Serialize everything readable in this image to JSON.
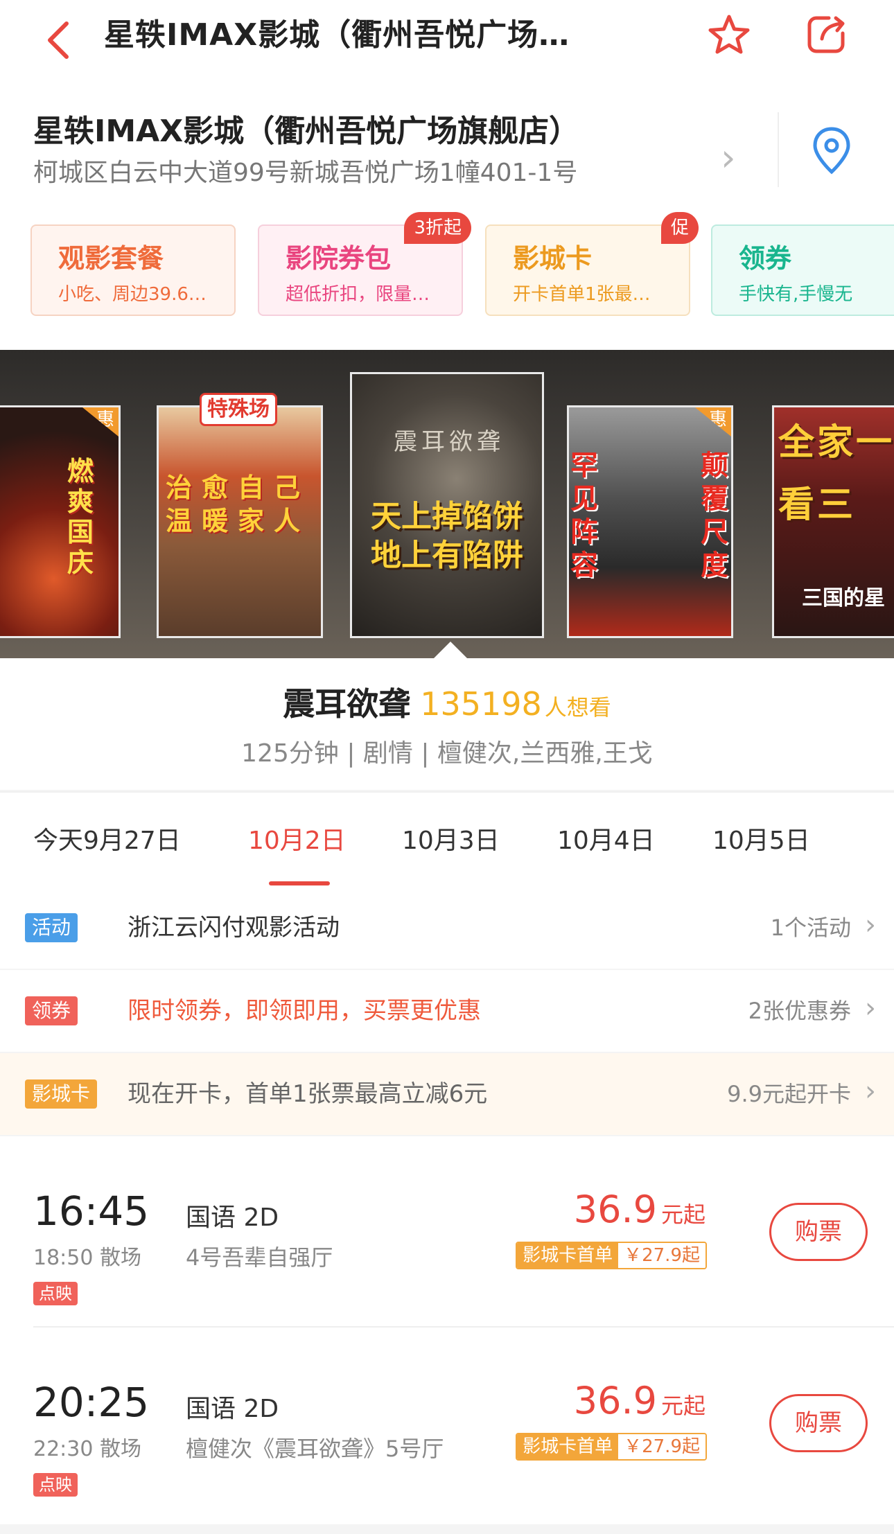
{
  "header": {
    "title": "星轶IMAX影城（衢州吾悦广场…"
  },
  "cinema": {
    "name": "星轶IMAX影城（衢州吾悦广场旗舰店）",
    "address": "柯城区白云中大道99号新城吾悦广场1幢401-1号",
    "arrow": "›"
  },
  "services": [
    {
      "title": "观影套餐",
      "desc": "小吃、周边39.6…",
      "badge": ""
    },
    {
      "title": "影院券包",
      "desc": "超低折扣，限量…",
      "badge": "3折起"
    },
    {
      "title": "影城卡",
      "desc": "开卡首单1张最…",
      "badge": "促"
    },
    {
      "title": "领券",
      "desc": "手快有,手慢无",
      "badge": ""
    }
  ],
  "posters": [
    {
      "badge": "惠",
      "caption": "燃爽国庆"
    },
    {
      "badge": "特殊场",
      "caption": "治愈自己 温暖家人"
    },
    {
      "badge": "",
      "caption": "天上掉馅饼 地上有陷阱",
      "subtitle": "震耳欲聋"
    },
    {
      "badge": "惠",
      "caption_left": "罕见阵容",
      "caption_right": "颠覆尺度"
    },
    {
      "badge": "",
      "caption": "全家一 看三",
      "subtitle": "三国的星"
    }
  ],
  "movie": {
    "title": "震耳欲聋",
    "want_count": "135198",
    "want_label": "人想看",
    "meta": "125分钟 | 剧情 | 檀健次,兰西雅,王戈"
  },
  "dates": [
    "今天9月27日",
    "10月2日",
    "10月3日",
    "10月4日",
    "10月5日"
  ],
  "promos": {
    "activity": {
      "tag": "活动",
      "text": "浙江云闪付观影活动",
      "right": "1个活动"
    },
    "coupon": {
      "tag": "领券",
      "text": "限时领券，即领即用，买票更优惠",
      "right": "2张优惠券"
    },
    "card": {
      "tag": "影城卡",
      "text": "现在开卡，首单1张票最高立减6元",
      "right": "9.9元起开卡"
    }
  },
  "arrow_glyph": "›",
  "showtimes": [
    {
      "start": "16:45",
      "end": "18:50 散场",
      "tag": "点映",
      "lang": "国语 2D",
      "hall": "4号吾辈自强厅",
      "price": "36.9",
      "price_suffix": "元起",
      "card_label": "影城卡首单",
      "card_price": "￥27.9起",
      "buy": "购票"
    },
    {
      "start": "20:25",
      "end": "22:30 散场",
      "tag": "点映",
      "lang": "国语 2D",
      "hall": "檀健次《震耳欲聋》5号厅",
      "price": "36.9",
      "price_suffix": "元起",
      "card_label": "影城卡首单",
      "card_price": "￥27.9起",
      "buy": "购票"
    }
  ],
  "colors": {
    "accent": "#e8483f",
    "gold": "#f3b021",
    "activity_tag": "#4a9ee8",
    "card_tag": "#f3a63a"
  }
}
